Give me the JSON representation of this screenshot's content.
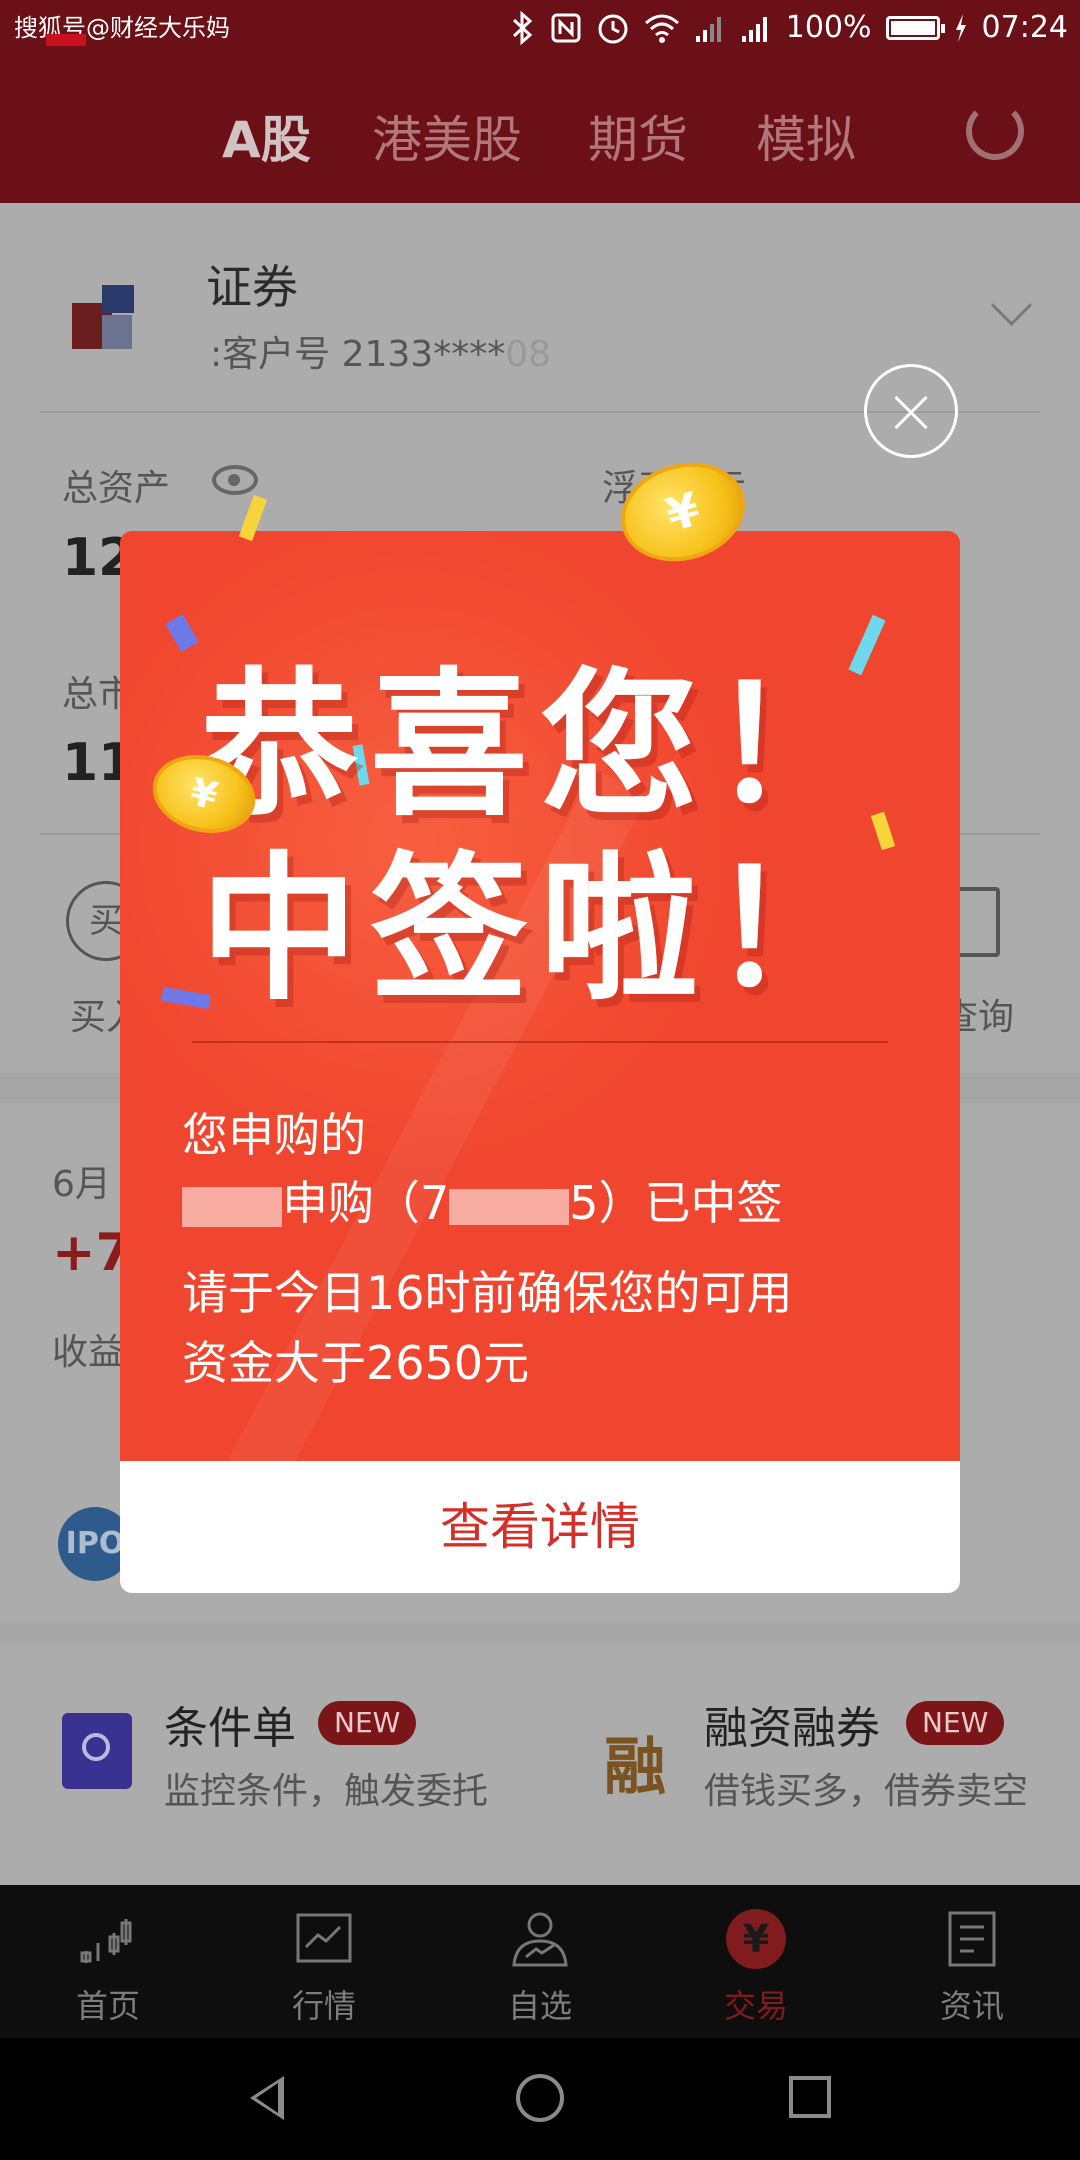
{
  "status_bar": {
    "watermark": "搜狐号@财经大乐妈",
    "network": "2G 4G",
    "battery": "100%",
    "time": "07:24"
  },
  "top_nav": {
    "tabs": [
      "A股",
      "港美股",
      "期货",
      "模拟"
    ],
    "active": "A股"
  },
  "account": {
    "broker_name": "证券",
    "account_number": ":客户号 2133****",
    "account_suffix": "08"
  },
  "assets": {
    "total_assets_label": "总资产",
    "total_assets_value": "12",
    "floating_pl_label": "浮动盈亏",
    "market_value_label": "总市",
    "market_value_value": "11"
  },
  "actions": {
    "buy_icon": "买",
    "buy_label": "买入",
    "query_label": "查询"
  },
  "earnings": {
    "date": "6月",
    "value": "+7",
    "label": "收益"
  },
  "ipo": {
    "badge": "IPO"
  },
  "features": [
    {
      "title": "条件单",
      "badge": "NEW",
      "subtitle": "监控条件，触发委托",
      "icon": "lightbulb-icon"
    },
    {
      "title": "融资融券",
      "badge": "NEW",
      "subtitle": "借钱买多，借券卖空",
      "icon_text": "融"
    }
  ],
  "bottom_tabs": [
    {
      "label": "首页",
      "icon": "candlestick-icon"
    },
    {
      "label": "行情",
      "icon": "chart-icon"
    },
    {
      "label": "自选",
      "icon": "user-chart-icon"
    },
    {
      "label": "交易",
      "icon": "yen-icon",
      "active": true,
      "symbol": "¥"
    },
    {
      "label": "资讯",
      "icon": "document-icon"
    }
  ],
  "popup": {
    "headline_1": "恭喜您！",
    "headline_2": "中签啦！",
    "line_1": "您申购的",
    "line_2": "申购（7",
    "line_2_suffix": "5）已中签",
    "line_3": "请于今日16时前确保您的可用",
    "line_4": "资金大于2650元",
    "button": "查看详情",
    "coin_symbol": "¥"
  },
  "colors": {
    "brand": "#801b1e",
    "popup_red": "#f0452e",
    "button_text": "#d4302a"
  }
}
